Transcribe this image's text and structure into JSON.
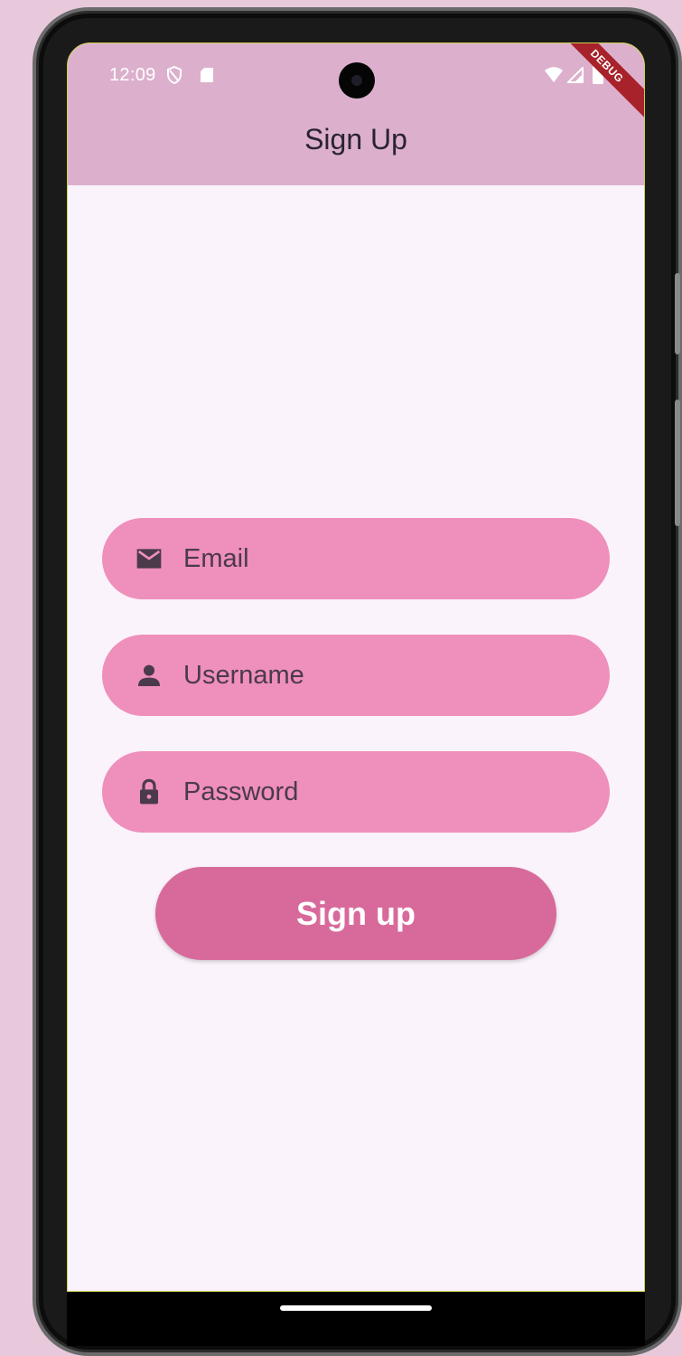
{
  "status_bar": {
    "time": "12:09",
    "icons": [
      "shield-icon",
      "sd-card-icon",
      "wifi-icon",
      "cellular-signal-icon",
      "battery-icon"
    ]
  },
  "debug_banner": {
    "label": "DEBUG"
  },
  "app_bar": {
    "title": "Sign Up"
  },
  "form": {
    "email": {
      "placeholder": "Email",
      "value": "",
      "icon": "mail-icon"
    },
    "username": {
      "placeholder": "Username",
      "value": "",
      "icon": "person-icon"
    },
    "password": {
      "placeholder": "Password",
      "value": "",
      "icon": "lock-icon"
    },
    "submit_label": "Sign up"
  },
  "colors": {
    "app_bar": "#dcb0cd",
    "screen_background": "#fbf3fb",
    "field_background": "#ef8fbb",
    "button_background": "#d86a9b",
    "icon_color": "#4a3a4a",
    "debug_banner": "#a7222a"
  }
}
